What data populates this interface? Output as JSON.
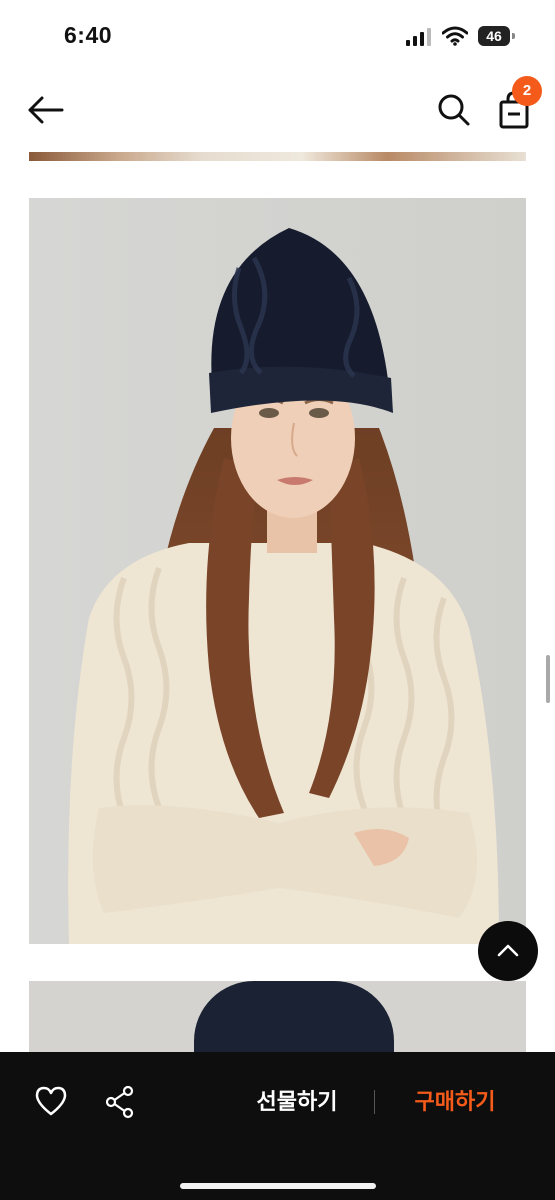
{
  "status_bar": {
    "time": "6:40",
    "battery": "46"
  },
  "nav": {
    "cart_count": "2",
    "icons": [
      "back-arrow-icon",
      "search-icon",
      "shopping-bag-icon"
    ]
  },
  "bottom_bar": {
    "gift_label": "선물하기",
    "buy_label": "구매하기",
    "icons": [
      "heart-icon",
      "share-icon"
    ]
  },
  "colors": {
    "accent": "#f45b1a",
    "bottom_bar_bg": "#0e0e0e",
    "scroll_top_bg": "#0c0c0c"
  }
}
